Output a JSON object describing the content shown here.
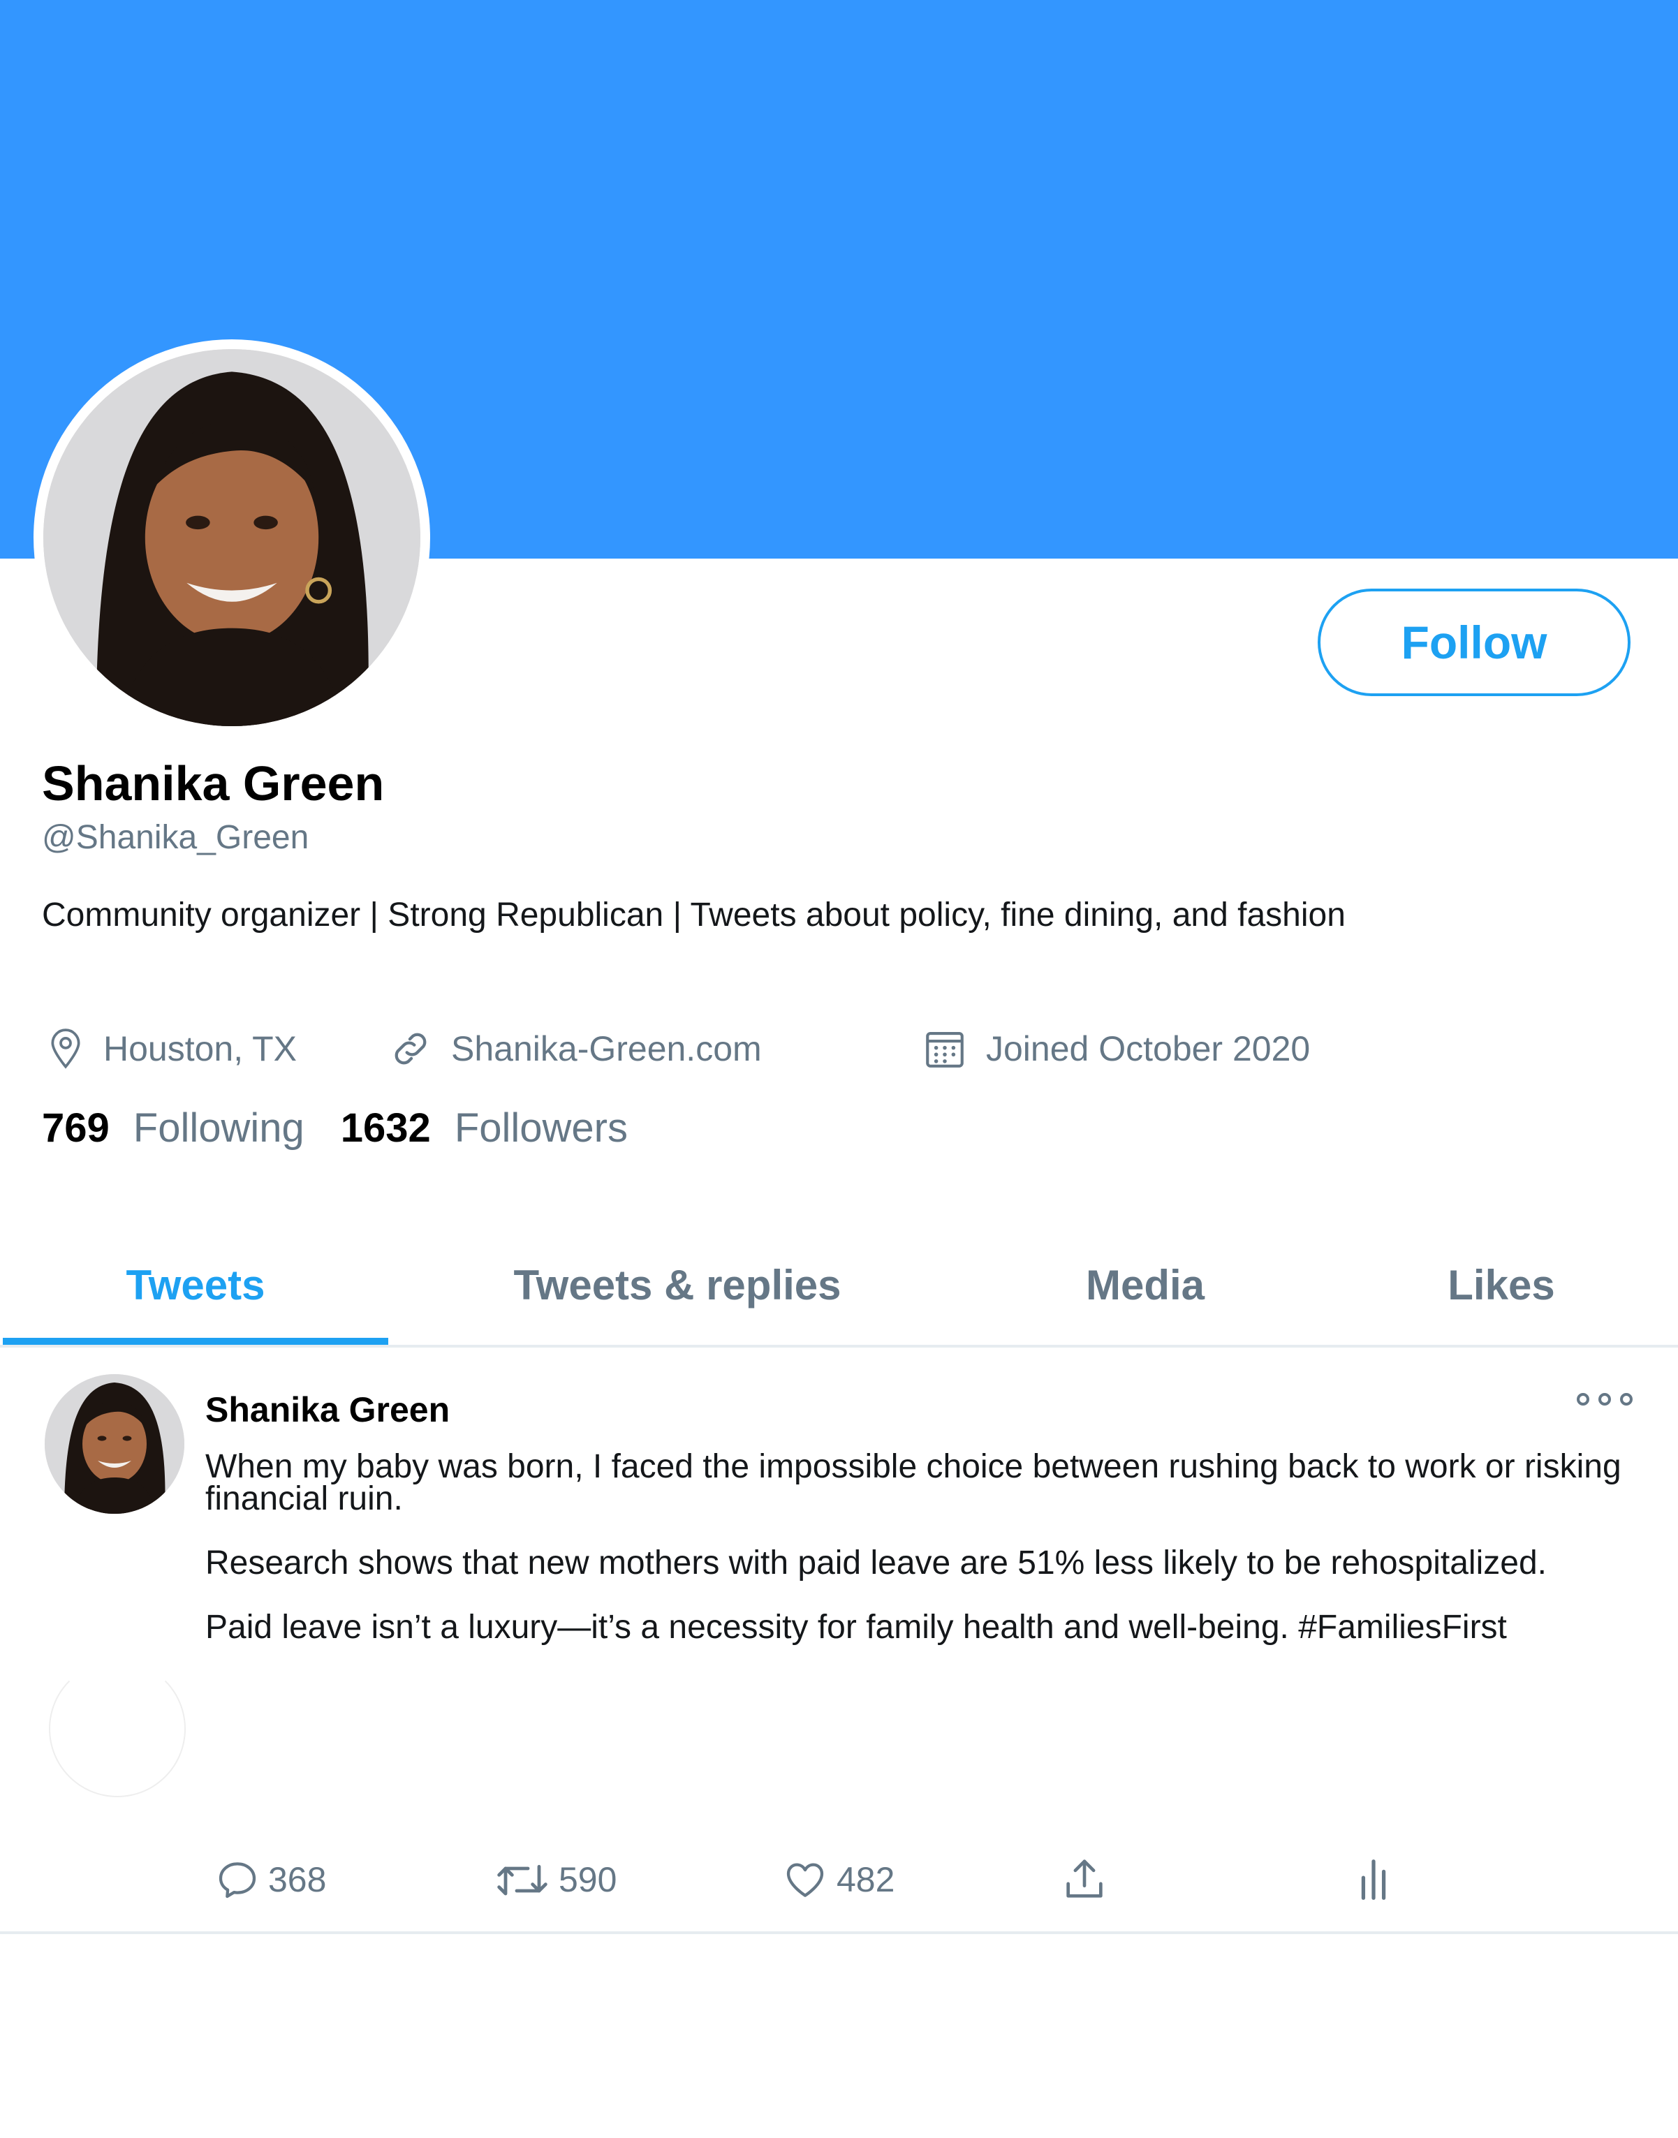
{
  "colors": {
    "banner": "#3396ff",
    "accent": "#1da1f2",
    "muted": "#657786",
    "text": "#14171a"
  },
  "profile": {
    "display_name": "Shanika Green",
    "handle": "@Shanika_Green",
    "bio": "Community organizer | Strong Republican | Tweets about policy, fine dining, and fashion",
    "follow_label": "Follow",
    "location": "Houston, TX",
    "website": "Shanika-Green.com",
    "joined": "Joined October 2020",
    "following_count": "769",
    "following_label": "Following",
    "followers_count": "1632",
    "followers_label": "Followers"
  },
  "tabs": [
    {
      "label": "Tweets",
      "active": true
    },
    {
      "label": "Tweets & replies",
      "active": false
    },
    {
      "label": "Media",
      "active": false
    },
    {
      "label": "Likes",
      "active": false
    }
  ],
  "tweet": {
    "author": "Shanika Green",
    "paragraphs": [
      "When my baby was born, I faced the impossible choice between rushing back to work or risking financial ruin.",
      "Research shows that new mothers with paid leave are 51% less likely to be rehospitalized.",
      "Paid leave isn’t a luxury—it’s a necessity for family health and well-being. #FamiliesFirst"
    ],
    "replies": "368",
    "retweets": "590",
    "likes": "482"
  },
  "icons": [
    "location-pin-icon",
    "link-icon",
    "calendar-icon",
    "more-options-icon",
    "reply-icon",
    "retweet-icon",
    "like-icon",
    "share-icon",
    "analytics-icon"
  ]
}
